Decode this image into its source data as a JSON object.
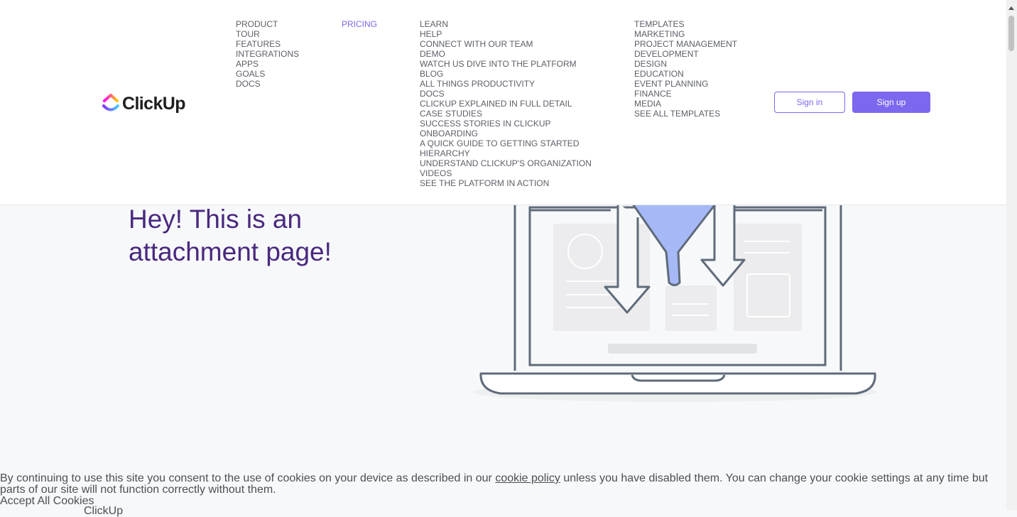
{
  "brand": {
    "name": "ClickUp"
  },
  "nav": {
    "columns": [
      {
        "items": [
          {
            "label": "PRODUCT"
          },
          {
            "label": "TOUR"
          },
          {
            "label": "FEATURES"
          },
          {
            "label": "INTEGRATIONS"
          },
          {
            "label": "APPS"
          },
          {
            "label": "GOALS"
          },
          {
            "label": "DOCS"
          }
        ]
      },
      {
        "items": [
          {
            "label": "PRICING"
          }
        ]
      },
      {
        "items": [
          {
            "label": "LEARN"
          },
          {
            "label": "HELP"
          },
          {
            "label": "CONNECT WITH OUR TEAM"
          },
          {
            "label": "DEMO"
          },
          {
            "label": "WATCH US DIVE INTO THE PLATFORM"
          },
          {
            "label": "BLOG"
          },
          {
            "label": "ALL THINGS PRODUCTIVITY"
          },
          {
            "label": "DOCS"
          },
          {
            "label": "CLICKUP EXPLAINED IN FULL DETAIL"
          },
          {
            "label": "CASE STUDIES"
          },
          {
            "label": "SUCCESS STORIES IN CLICKUP"
          },
          {
            "label": "ONBOARDING"
          },
          {
            "label": "A QUICK GUIDE TO GETTING STARTED"
          },
          {
            "label": "HIERARCHY"
          },
          {
            "label": "UNDERSTAND CLICKUP'S ORGANIZATION"
          },
          {
            "label": "VIDEOS"
          },
          {
            "label": "SEE THE PLATFORM IN ACTION"
          }
        ]
      },
      {
        "items": [
          {
            "label": "TEMPLATES"
          },
          {
            "label": "MARKETING"
          },
          {
            "label": "PROJECT MANAGEMENT"
          },
          {
            "label": "DEVELOPMENT"
          },
          {
            "label": "DESIGN"
          },
          {
            "label": "EDUCATION"
          },
          {
            "label": "EVENT PLANNING"
          },
          {
            "label": "FINANCE"
          },
          {
            "label": "MEDIA"
          },
          {
            "label": "SEE ALL TEMPLATES"
          }
        ]
      }
    ]
  },
  "auth": {
    "signin_label": "Sign in",
    "signup_label": "Sign up"
  },
  "hero": {
    "title": "Hey! This is an attachment page!"
  },
  "cookie": {
    "text_before": "By continuing to use this site you consent to the use of cookies on your device as described in our",
    "link_label": "cookie policy",
    "text_after": "unless you have disabled them. You can change your cookie settings at any time but parts of our site will not function correctly without them.",
    "accept_label": "Accept All Cookies",
    "trailing_text": "ClickUp"
  },
  "colors": {
    "accent": "#7b68ee",
    "hero_title": "#49287f",
    "nav_text": "#5d6068",
    "page_bg": "#f7f8fa"
  },
  "icons": {
    "logo": "clickup-logo-icon",
    "illustration": "laptop-funnel-illustration",
    "scroll_up": "scroll-up-arrow-icon"
  }
}
